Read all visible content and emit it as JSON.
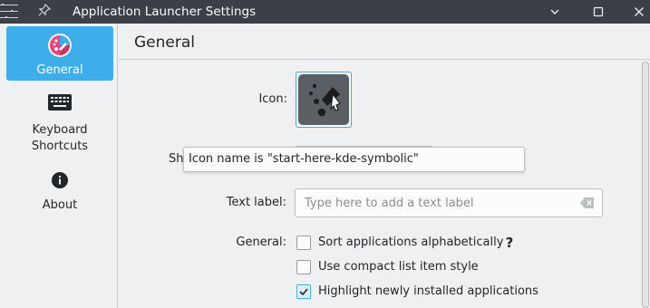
{
  "window": {
    "title": "Application Launcher Settings",
    "buttons": {
      "minimize_icon": "minimize-icon",
      "maximize_icon": "maximize-icon",
      "close_icon": "close-icon"
    }
  },
  "sidebar": {
    "items": [
      {
        "label": "General",
        "icon": "kde-launcher-icon",
        "selected": true
      },
      {
        "label": "Keyboard\nShortcuts",
        "icon": "keyboard-icon",
        "selected": false
      },
      {
        "label": "About",
        "icon": "info-icon",
        "selected": false
      }
    ]
  },
  "page": {
    "title": "General",
    "icon_label": "Icon:",
    "shortcut_label_partial": "Sh",
    "tooltip": "Icon name is \"start-here-kde-symbolic\"",
    "text_label": "Text label:",
    "text_placeholder": "Type here to add a text label",
    "text_value": "",
    "general_label": "General:",
    "options": [
      {
        "label": "Sort applications alphabetically",
        "checked": false
      },
      {
        "label": "Use compact list item style",
        "checked": false
      },
      {
        "label": "Highlight newly installed applications",
        "checked": true
      }
    ],
    "help_glyph": "?"
  },
  "colors": {
    "accent": "#3daee9",
    "titlebar": "#3a4046",
    "background": "#eff0f1"
  }
}
